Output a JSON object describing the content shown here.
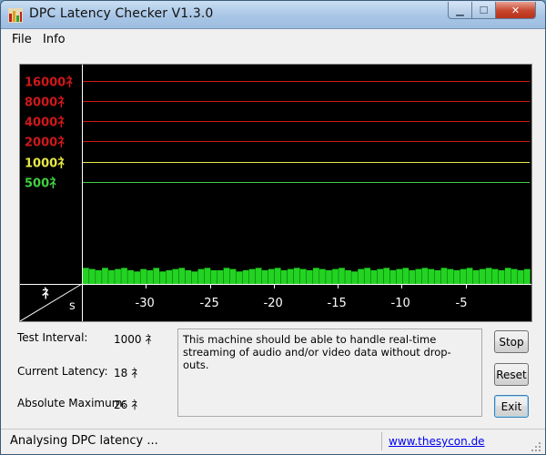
{
  "window": {
    "title": "DPC Latency Checker V1.3.0",
    "controls": {
      "minimize": "▁",
      "maximize": "☐",
      "close": "✕"
    }
  },
  "menu": {
    "file": "File",
    "info": "Info"
  },
  "chart_data": {
    "type": "bar",
    "y_tick_labels": [
      {
        "text": "16000礻",
        "color": "#d01818"
      },
      {
        "text": "8000礻",
        "color": "#d01818"
      },
      {
        "text": "4000礻",
        "color": "#d01818"
      },
      {
        "text": "2000礻",
        "color": "#d01818"
      },
      {
        "text": "1000礻",
        "color": "#e8e84a"
      },
      {
        "text": "500礻",
        "color": "#40d040"
      }
    ],
    "y_values": [
      16000,
      8000,
      4000,
      2000,
      1000,
      500
    ],
    "y_scale": "log",
    "x_tick_labels": [
      "-30",
      "-25",
      "-20",
      "-15",
      "-10",
      "-5"
    ],
    "x_unit": "s",
    "y_unit": "礻",
    "xlim": [
      -35,
      0
    ],
    "bar_color": "#22d322",
    "values": [
      26,
      25,
      24,
      26,
      24,
      25,
      26,
      24,
      23,
      25,
      24,
      26,
      23,
      24,
      25,
      26,
      24,
      23,
      25,
      26,
      24,
      24,
      26,
      25,
      23,
      24,
      25,
      26,
      24,
      25,
      26,
      24,
      25,
      26,
      25,
      24,
      26,
      25,
      24,
      25,
      26,
      24,
      23,
      25,
      26,
      24,
      25,
      26,
      24,
      25,
      26,
      24,
      25,
      26,
      25,
      24,
      26,
      25,
      24,
      25,
      26,
      24,
      25,
      26,
      25,
      24,
      26,
      25,
      24,
      25
    ]
  },
  "info": {
    "test_interval_label": "Test Interval:",
    "test_interval_value": "1000 礻",
    "current_latency_label": "Current Latency:",
    "current_latency_value": "18 礻",
    "absolute_maximum_label": "Absolute Maximum:",
    "absolute_maximum_value": "26 礻",
    "message": "This machine should be able to handle real-time streaming of audio and/or video data without drop-outs."
  },
  "buttons": {
    "stop": "Stop",
    "reset": "Reset",
    "exit": "Exit"
  },
  "status": {
    "text": "Analysing DPC latency ...",
    "link": "www.thesycon.de"
  }
}
